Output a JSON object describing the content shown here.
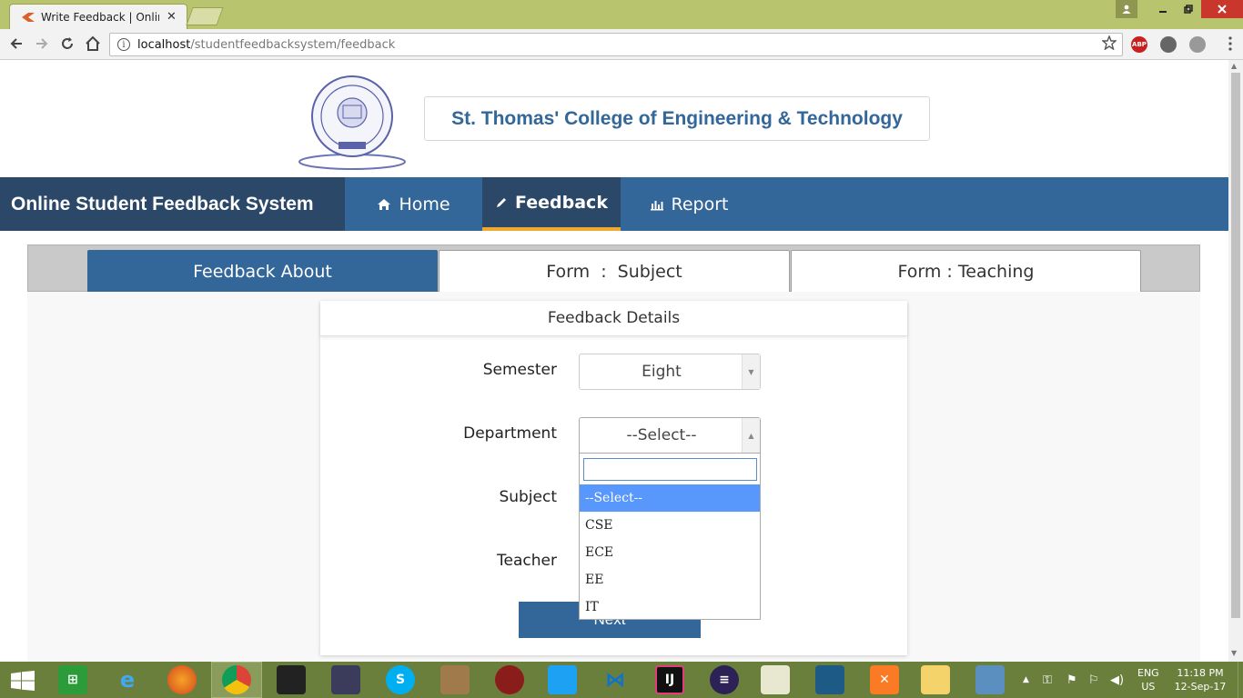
{
  "browser": {
    "tab_title": "Write Feedback | Online",
    "tab_close": "✕",
    "url_host": "localhost",
    "url_path": "/studentfeedbacksystem/feedback",
    "ext_abp": "ABP"
  },
  "header": {
    "college_name": "St. Thomas' College of Engineering & Technology"
  },
  "navbar": {
    "brand": "Online Student Feedback System",
    "items": [
      {
        "label": "Home",
        "icon": "home-icon"
      },
      {
        "label": "Feedback",
        "icon": "pencil-icon",
        "active": true
      },
      {
        "label": "Report",
        "icon": "bar-chart-icon"
      }
    ]
  },
  "form_tabs": [
    {
      "label": "Feedback About",
      "active": true
    },
    {
      "label": "Form  :  Subject"
    },
    {
      "label": "Form : Teaching"
    }
  ],
  "panel": {
    "title": "Feedback Details",
    "fields": {
      "semester_label": "Semester",
      "semester_value": "Eight",
      "department_label": "Department",
      "department_value": "--Select--",
      "subject_label": "Subject",
      "teacher_label": "Teacher"
    },
    "next_label": "Next"
  },
  "department_dropdown": {
    "search_value": "",
    "options": [
      "--Select--",
      "CSE",
      "ECE",
      "EE",
      "IT"
    ],
    "highlighted_index": 0
  },
  "taskbar": {
    "lang_top": "ENG",
    "lang_bottom": "US",
    "time": "11:18 PM",
    "date": "12-Sep-17"
  },
  "colors": {
    "primary": "#336699",
    "brand_bg": "#2c4868",
    "accent": "#f0a830",
    "dropdown_highlight": "#5897fb"
  }
}
